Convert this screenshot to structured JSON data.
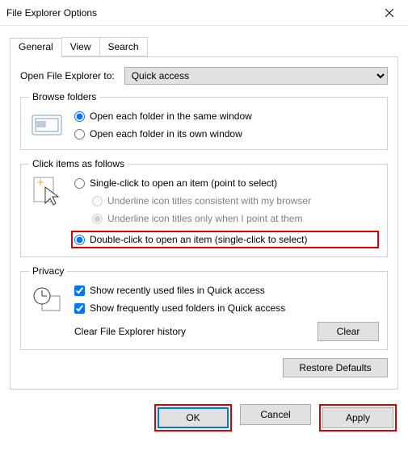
{
  "window": {
    "title": "File Explorer Options"
  },
  "tabs": {
    "t0": "General",
    "t1": "View",
    "t2": "Search"
  },
  "open_to": {
    "label": "Open File Explorer to:",
    "value": "Quick access"
  },
  "browse": {
    "legend": "Browse folders",
    "r0": "Open each folder in the same window",
    "r1": "Open each folder in its own window"
  },
  "click": {
    "legend": "Click items as follows",
    "r0": "Single-click to open an item (point to select)",
    "s0": "Underline icon titles consistent with my browser",
    "s1": "Underline icon titles only when I point at them",
    "r1": "Double-click to open an item (single-click to select)"
  },
  "privacy": {
    "legend": "Privacy",
    "c0": "Show recently used files in Quick access",
    "c1": "Show frequently used folders in Quick access",
    "clear_label": "Clear File Explorer history",
    "clear_btn": "Clear"
  },
  "restore": "Restore Defaults",
  "footer": {
    "ok": "OK",
    "cancel": "Cancel",
    "apply": "Apply"
  }
}
